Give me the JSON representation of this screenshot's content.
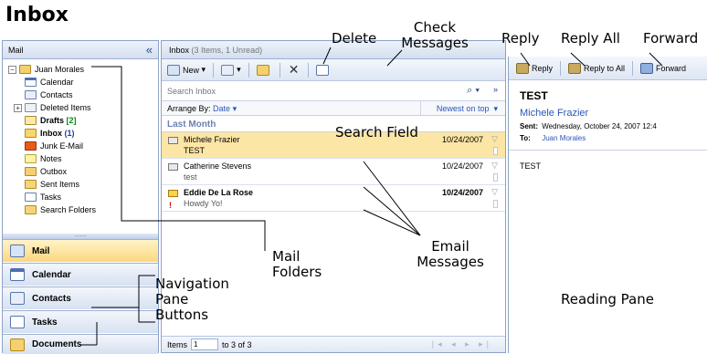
{
  "page_title": "Inbox",
  "callouts": {
    "delete": "Delete",
    "check_messages_1": "Check",
    "check_messages_2": "Messages",
    "reply": "Reply",
    "reply_all": "Reply All",
    "forward": "Forward",
    "search_field": "Search Field",
    "email_messages_1": "Email",
    "email_messages_2": "Messages",
    "mail_folders_1": "Mail",
    "mail_folders_2": "Folders",
    "nav_buttons_1": "Navigation",
    "nav_buttons_2": "Pane",
    "nav_buttons_3": "Buttons",
    "reading_pane": "Reading Pane"
  },
  "nav": {
    "header": "Mail",
    "collapse": "«",
    "splitter": "........",
    "tree": {
      "root": "Juan Morales",
      "calendar": "Calendar",
      "contacts": "Contacts",
      "deleted": "Deleted Items",
      "drafts": "Drafts",
      "drafts_count": "[2]",
      "inbox": "Inbox",
      "inbox_count": "(1)",
      "junk": "Junk E-Mail",
      "notes": "Notes",
      "outbox": "Outbox",
      "sent": "Sent Items",
      "tasks": "Tasks",
      "search": "Search Folders"
    },
    "buttons": {
      "mail": "Mail",
      "calendar": "Calendar",
      "contacts": "Contacts",
      "tasks": "Tasks",
      "documents": "Documents"
    }
  },
  "list": {
    "title": "Inbox",
    "count": "(3 Items, 1 Unread)",
    "toolbar": {
      "new": "New",
      "dropdown": "▾"
    },
    "search_placeholder": "Search Inbox",
    "search_icon": "⌕ ▾",
    "search_expand": "»",
    "arrange_label": "Arrange By:",
    "arrange_value": "Date",
    "sort_label": "Newest on top",
    "group_label": "Last Month",
    "messages": [
      {
        "from": "Michele Frazier",
        "subject": "TEST",
        "date": "10/24/2007",
        "important": ""
      },
      {
        "from": "Catherine Stevens",
        "subject": "test",
        "date": "10/24/2007",
        "important": ""
      },
      {
        "from": "Eddie De La Rose",
        "subject": "Howdy Yo!",
        "date": "10/24/2007",
        "important": "!"
      }
    ],
    "status": {
      "items_label": "Items",
      "items_value": "1",
      "range": "to 3 of 3",
      "pager": "|◂ ◂ ▸ ▸|"
    }
  },
  "reading": {
    "toolbar": {
      "reply": "Reply",
      "reply_all": "Reply to All",
      "forward": "Forward"
    },
    "subject": "TEST",
    "from": "Michele Frazier",
    "sent_label": "Sent:",
    "sent_value": "Wednesday, October 24, 2007 12:4",
    "to_label": "To:",
    "to_value": "Juan Morales",
    "body": "TEST"
  }
}
